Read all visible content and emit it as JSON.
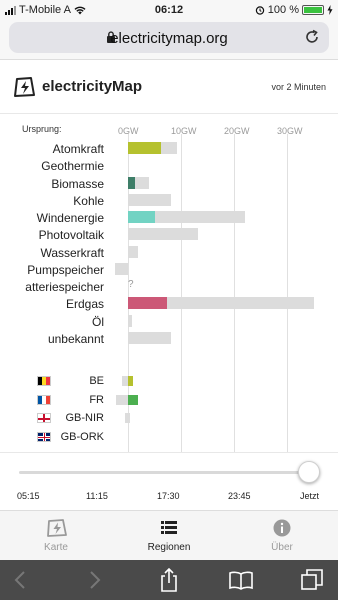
{
  "status": {
    "carrier": "T-Mobile A",
    "time": "06:12",
    "battery": "100 %"
  },
  "browser": {
    "url": "electricitymap.org"
  },
  "header": {
    "brand": "electricityMap",
    "updated": "vor 2 Minuten"
  },
  "chart": {
    "legend_label": "Ursprung:",
    "ticks": [
      "0GW",
      "10GW",
      "20GW",
      "30GW"
    ]
  },
  "chart_data": {
    "type": "bar",
    "unit": "GW",
    "xlim": [
      0,
      35
    ],
    "categories": [
      "Atomkraft",
      "Geothermie",
      "Biomasse",
      "Kohle",
      "Windenergie",
      "Photovoltaik",
      "Wasserkraft",
      "Pumpspeicher",
      "atteriespeicher",
      "Erdgas",
      "Öl",
      "unbekannt"
    ],
    "series": [
      {
        "values": [
          6.2,
          0,
          1.3,
          0,
          5.0,
          0,
          0,
          0,
          null,
          7.4,
          0,
          0
        ]
      },
      {
        "values": [
          9.2,
          0,
          4.0,
          8.2,
          22.0,
          13.2,
          1.8,
          -2.4,
          null,
          35.0,
          0.8,
          8.2
        ]
      }
    ],
    "colors": [
      "#b5c12e",
      null,
      "#3e7e68",
      null,
      "#72d3c3",
      null,
      null,
      null,
      null,
      "#cc5877",
      null,
      null
    ],
    "missing_marker": "?"
  },
  "countries": [
    {
      "code": "BE",
      "flag": "be-flag-icon",
      "import_start": -1.2,
      "import_end": 0,
      "value": 1.0,
      "color": "#b5c12e"
    },
    {
      "code": "FR",
      "flag": "fr-flag-icon",
      "import_start": -2.2,
      "import_end": 0,
      "value": 1.8,
      "color": "#4caf50"
    },
    {
      "code": "GB-NIR",
      "flag": "gb-nir-flag-icon",
      "import_start": -0.6,
      "import_end": 0.3,
      "value": 0,
      "color": "#dcdcdc"
    },
    {
      "code": "GB-ORK",
      "flag": "gb-ork-flag-icon",
      "import_start": 0,
      "import_end": 0,
      "value": 0,
      "color": "#dcdcdc"
    }
  ],
  "timeline": {
    "labels": [
      "05:15",
      "11:15",
      "17:30",
      "23:45",
      "Jetzt"
    ]
  },
  "tabs": [
    {
      "label": "Karte",
      "icon": "map-logo-icon",
      "active": false
    },
    {
      "label": "Regionen",
      "icon": "list-icon",
      "active": true
    },
    {
      "label": "Über",
      "icon": "info-icon",
      "active": false
    }
  ],
  "colors": {
    "accent": "#b5c12e",
    "tab_active": "#222222",
    "tab_inactive": "#999999"
  }
}
